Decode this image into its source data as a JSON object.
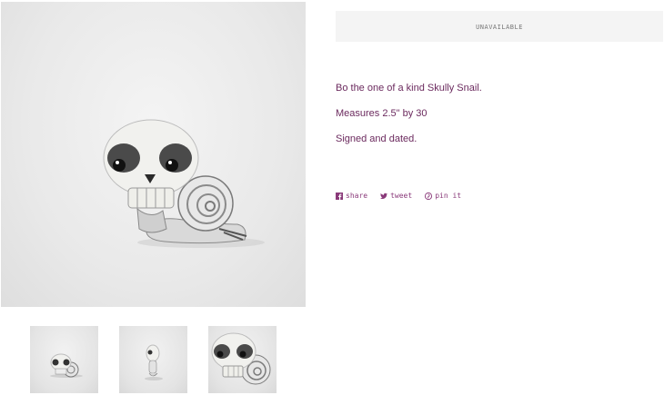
{
  "product": {
    "status_button": "unavailable",
    "description": [
      "Bo the one of a kind Skully Snail.",
      "Measures 2.5\" by 30",
      "Signed and dated."
    ],
    "share": {
      "facebook": "share",
      "twitter": "tweet",
      "pinterest": "pin it"
    }
  },
  "colors": {
    "text_accent": "#6b2a5e",
    "button_bg": "#f4f4f4",
    "button_text": "#777777"
  },
  "icons": [
    "facebook-icon",
    "twitter-icon",
    "pinterest-icon"
  ]
}
